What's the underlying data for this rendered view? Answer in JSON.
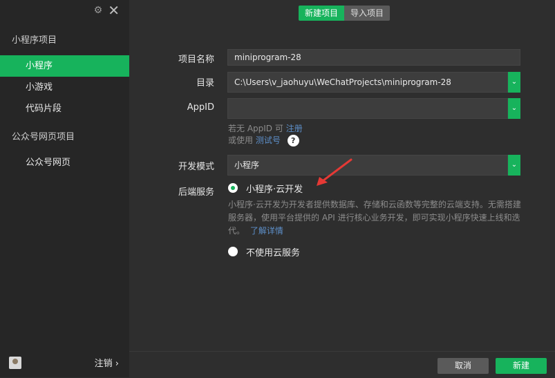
{
  "window": {
    "settings_icon": "gear-icon",
    "close_icon": "close-icon"
  },
  "sidebar": {
    "section_miniprogram": "小程序项目",
    "items_mini": [
      {
        "label": "小程序",
        "active": true
      },
      {
        "label": "小游戏",
        "active": false
      },
      {
        "label": "代码片段",
        "active": false
      }
    ],
    "section_official": "公众号网页项目",
    "items_official": [
      {
        "label": "公众号网页",
        "active": false
      }
    ],
    "logout_label": "注销",
    "logout_chevron": "›"
  },
  "tabs": {
    "new_project": "新建项目",
    "import_project": "导入项目"
  },
  "form": {
    "project_name_label": "项目名称",
    "project_name_value": "miniprogram-28",
    "directory_label": "目录",
    "directory_value": "C:\\Users\\v_jaohuyu\\WeChatProjects\\miniprogram-28",
    "appid_label": "AppID",
    "appid_value": "",
    "hint_line1_prefix": "若无 AppID 可",
    "hint_line1_link": "注册",
    "hint_line2_prefix": "或使用",
    "hint_line2_link": "测试号",
    "help_mark": "?",
    "dev_mode_label": "开发模式",
    "dev_mode_value": "小程序",
    "backend_label": "后端服务",
    "option_cloud": "小程序·云开发",
    "cloud_description": "小程序·云开发为开发者提供数据库、存储和云函数等完整的云端支持。无需搭建服务器，使用平台提供的 API 进行核心业务开发，即可实现小程序快速上线和迭代。",
    "learn_more": "了解详情",
    "option_no_cloud": "不使用云服务",
    "selected_option": "cloud",
    "dropdown_chevron": "⌄"
  },
  "actions": {
    "cancel": "取消",
    "create": "新建"
  },
  "colors": {
    "accent": "#17b35c",
    "background": "#2e2e2e",
    "sidebar": "#262626",
    "annotation_arrow": "#e53935"
  }
}
